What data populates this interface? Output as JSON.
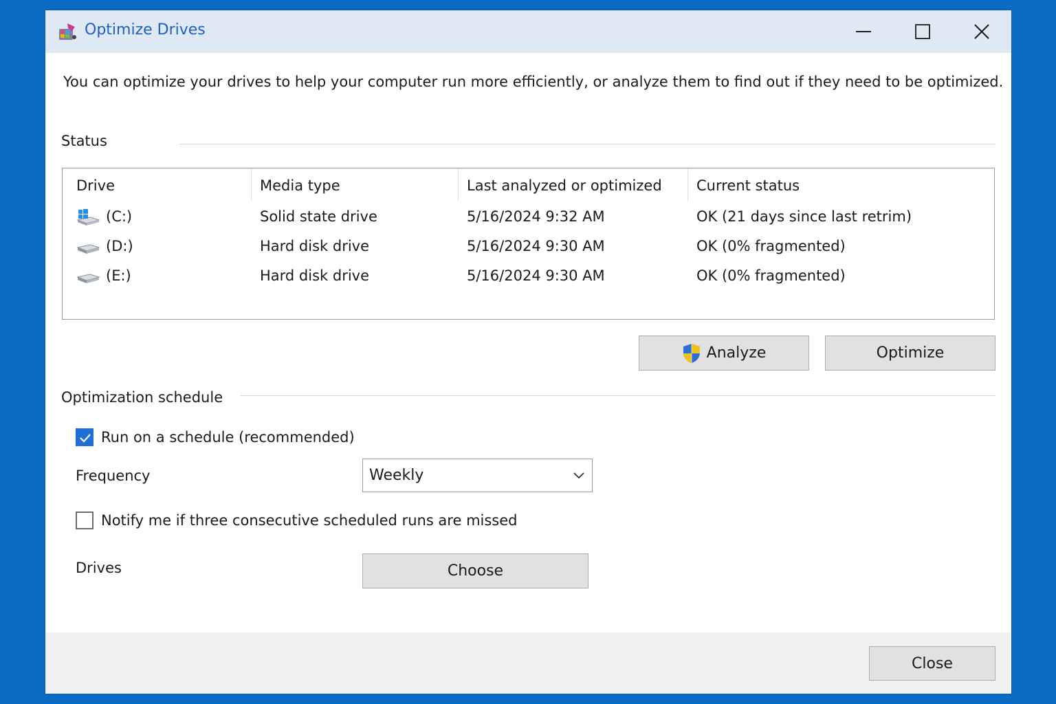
{
  "window": {
    "title": "Optimize Drives",
    "controls": {
      "minimize": "minimize-icon",
      "maximize": "maximize-icon",
      "close": "close-icon"
    }
  },
  "intro": "You can optimize your drives to help your computer run more efficiently, or analyze them to find out if they need to be optimized.",
  "status": {
    "label": "Status",
    "columns": [
      "Drive",
      "Media type",
      "Last analyzed or optimized",
      "Current status"
    ],
    "drives": [
      {
        "icon": "windows-drive-icon",
        "name": "(C:)",
        "media": "Solid state drive",
        "last": "5/16/2024 9:32 AM",
        "status": "OK (21 days since last retrim)"
      },
      {
        "icon": "hard-drive-icon",
        "name": "(D:)",
        "media": "Hard disk drive",
        "last": "5/16/2024 9:30 AM",
        "status": "OK (0% fragmented)"
      },
      {
        "icon": "hard-drive-icon",
        "name": "(E:)",
        "media": "Hard disk drive",
        "last": "5/16/2024 9:30 AM",
        "status": "OK (0% fragmented)"
      }
    ]
  },
  "actions": {
    "analyze": "Analyze",
    "optimize": "Optimize"
  },
  "schedule": {
    "label": "Optimization schedule",
    "run_on_schedule": {
      "label": "Run on a schedule (recommended)",
      "checked": true
    },
    "frequency": {
      "label": "Frequency",
      "value": "Weekly"
    },
    "notify": {
      "label": "Notify me if three consecutive scheduled runs are missed",
      "checked": false
    },
    "drives": {
      "label": "Drives",
      "button": "Choose"
    }
  },
  "footer": {
    "close": "Close"
  },
  "colors": {
    "desktop": "#0a6bc4",
    "titlebar": "#dfe9f4",
    "title_text": "#1f5fbf",
    "checkbox_accent": "#1f6fd6"
  }
}
